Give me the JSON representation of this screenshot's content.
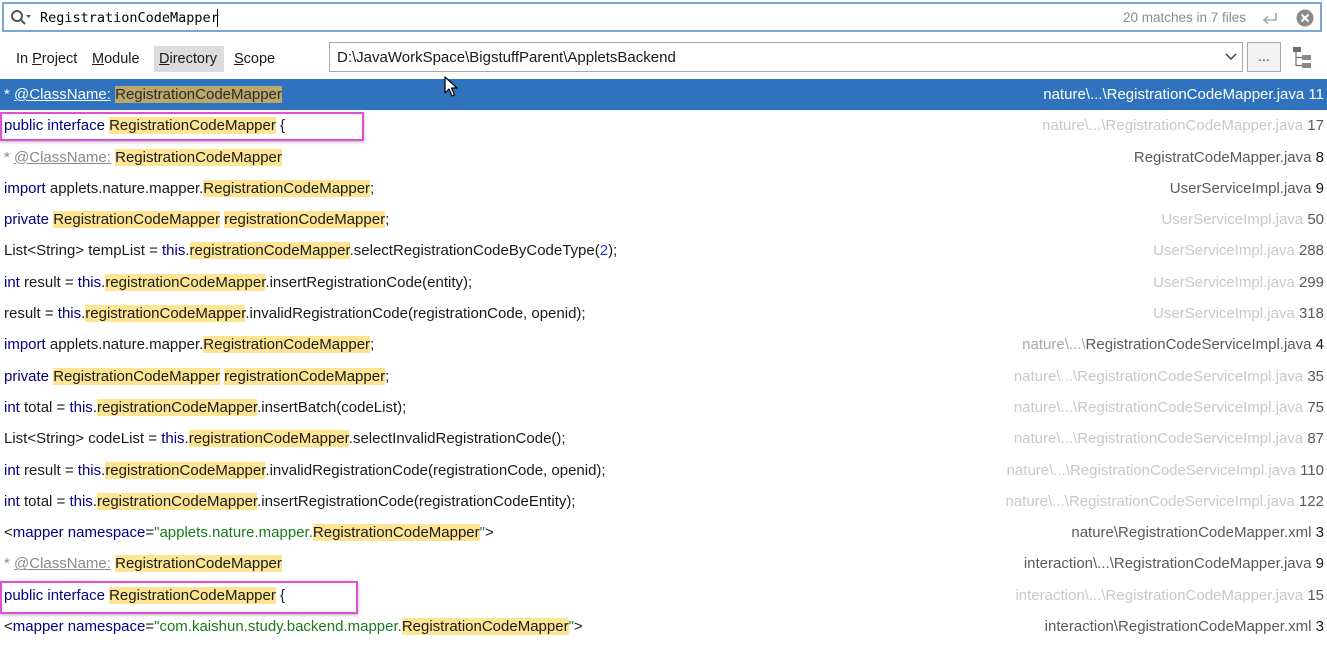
{
  "search": {
    "query": "RegistrationCodeMapper",
    "match_summary": "20 matches in 7 files"
  },
  "icons": {
    "search": "search-icon",
    "enter": "enter-icon",
    "clear": "clear-icon",
    "dropdown": "chevron-down-icon",
    "tree": "tree-view-icon",
    "cursor": "mouse-pointer-icon"
  },
  "scope_tabs": [
    {
      "pre": "In ",
      "mn": "P",
      "post": "roject",
      "selected": false
    },
    {
      "pre": "",
      "mn": "M",
      "post": "odule",
      "selected": false
    },
    {
      "pre": "",
      "mn": "D",
      "post": "irectory",
      "selected": true
    },
    {
      "pre": "",
      "mn": "S",
      "post": "cope",
      "selected": false
    }
  ],
  "directory": {
    "path": "D:\\JavaWorkSpace\\BigstuffParent\\AppletsBackend",
    "browse_label": "..."
  },
  "results": [
    {
      "parts": [
        [
          "doc",
          "* "
        ],
        [
          "doc-tag",
          "@ClassName:"
        ],
        [
          "t",
          " "
        ],
        [
          "hl",
          "RegistrationCodeMapper"
        ]
      ],
      "loc_path": "nature\\...\\",
      "loc_file": "RegistrationCodeMapper.java",
      "loc_line": "11",
      "selected": true,
      "gray": false
    },
    {
      "parts": [
        [
          "kw",
          "public"
        ],
        [
          "t",
          " "
        ],
        [
          "kw",
          "interface"
        ],
        [
          "t",
          " "
        ],
        [
          "hl",
          "RegistrationCodeMapper"
        ],
        [
          "t",
          " {"
        ]
      ],
      "loc_path": "nature\\...\\",
      "loc_file": "RegistrationCodeMapper.java",
      "loc_line": "17",
      "selected": false,
      "gray": true
    },
    {
      "parts": [
        [
          "doc",
          "* "
        ],
        [
          "doc-tag",
          "@ClassName:"
        ],
        [
          "t",
          " "
        ],
        [
          "hl",
          "RegistrationCodeMapper"
        ]
      ],
      "loc_path": "",
      "loc_file": "RegistratCodeMapper.java",
      "loc_line": "8",
      "selected": false,
      "gray": false
    },
    {
      "parts": [
        [
          "kw",
          "import"
        ],
        [
          "t",
          " applets.nature.mapper."
        ],
        [
          "hl",
          "RegistrationCodeMapper"
        ],
        [
          "t",
          ";"
        ]
      ],
      "loc_path": "",
      "loc_file": "UserServiceImpl.java",
      "loc_line": "9",
      "selected": false,
      "gray": false
    },
    {
      "parts": [
        [
          "kw",
          "private"
        ],
        [
          "t",
          " "
        ],
        [
          "hl",
          "RegistrationCodeMapper"
        ],
        [
          "t",
          " "
        ],
        [
          "hl",
          "registrationCodeMapper"
        ],
        [
          "t",
          ";"
        ]
      ],
      "loc_path": "",
      "loc_file": "UserServiceImpl.java",
      "loc_line": "50",
      "selected": false,
      "gray": true
    },
    {
      "parts": [
        [
          "t",
          "List<String> tempList = "
        ],
        [
          "kw",
          "this"
        ],
        [
          "t",
          "."
        ],
        [
          "hl",
          "registrationCodeMapper"
        ],
        [
          "t",
          ".selectRegistrationCodeByCodeType("
        ],
        [
          "num",
          "2"
        ],
        [
          "t",
          ");"
        ]
      ],
      "loc_path": "",
      "loc_file": "UserServiceImpl.java",
      "loc_line": "288",
      "selected": false,
      "gray": true
    },
    {
      "parts": [
        [
          "kw",
          "int"
        ],
        [
          "t",
          " result = "
        ],
        [
          "kw",
          "this"
        ],
        [
          "t",
          "."
        ],
        [
          "hl",
          "registrationCodeMapper"
        ],
        [
          "t",
          ".insertRegistrationCode(entity);"
        ]
      ],
      "loc_path": "",
      "loc_file": "UserServiceImpl.java",
      "loc_line": "299",
      "selected": false,
      "gray": true
    },
    {
      "parts": [
        [
          "t",
          "result = "
        ],
        [
          "kw",
          "this"
        ],
        [
          "t",
          "."
        ],
        [
          "hl",
          "registrationCodeMapper"
        ],
        [
          "t",
          ".invalidRegistrationCode(registrationCode, openid);"
        ]
      ],
      "loc_path": "",
      "loc_file": "UserServiceImpl.java",
      "loc_line": "318",
      "selected": false,
      "gray": true
    },
    {
      "parts": [
        [
          "kw",
          "import"
        ],
        [
          "t",
          " applets.nature.mapper."
        ],
        [
          "hl",
          "RegistrationCodeMapper"
        ],
        [
          "t",
          ";"
        ]
      ],
      "loc_path": "nature\\...\\",
      "loc_file": "RegistrationCodeServiceImpl.java",
      "loc_line": "4",
      "selected": false,
      "gray": false
    },
    {
      "parts": [
        [
          "kw",
          "private"
        ],
        [
          "t",
          " "
        ],
        [
          "hl",
          "RegistrationCodeMapper"
        ],
        [
          "t",
          " "
        ],
        [
          "hl",
          "registrationCodeMapper"
        ],
        [
          "t",
          ";"
        ]
      ],
      "loc_path": "nature\\...\\",
      "loc_file": "RegistrationCodeServiceImpl.java",
      "loc_line": "35",
      "selected": false,
      "gray": true
    },
    {
      "parts": [
        [
          "kw",
          "int"
        ],
        [
          "t",
          " total = "
        ],
        [
          "kw",
          "this"
        ],
        [
          "t",
          "."
        ],
        [
          "hl",
          "registrationCodeMapper"
        ],
        [
          "t",
          ".insertBatch(codeList);"
        ]
      ],
      "loc_path": "nature\\...\\",
      "loc_file": "RegistrationCodeServiceImpl.java",
      "loc_line": "75",
      "selected": false,
      "gray": true
    },
    {
      "parts": [
        [
          "t",
          "List<String> codeList = "
        ],
        [
          "kw",
          "this"
        ],
        [
          "t",
          "."
        ],
        [
          "hl",
          "registrationCodeMapper"
        ],
        [
          "t",
          ".selectInvalidRegistrationCode();"
        ]
      ],
      "loc_path": "nature\\...\\",
      "loc_file": "RegistrationCodeServiceImpl.java",
      "loc_line": "87",
      "selected": false,
      "gray": true
    },
    {
      "parts": [
        [
          "kw",
          "int"
        ],
        [
          "t",
          " result = "
        ],
        [
          "kw",
          "this"
        ],
        [
          "t",
          "."
        ],
        [
          "hl",
          "registrationCodeMapper"
        ],
        [
          "t",
          ".invalidRegistrationCode(registrationCode, openid);"
        ]
      ],
      "loc_path": "nature\\...\\",
      "loc_file": "RegistrationCodeServiceImpl.java",
      "loc_line": "110",
      "selected": false,
      "gray": true
    },
    {
      "parts": [
        [
          "kw",
          "int"
        ],
        [
          "t",
          " total = "
        ],
        [
          "kw",
          "this"
        ],
        [
          "t",
          "."
        ],
        [
          "hl",
          "registrationCodeMapper"
        ],
        [
          "t",
          ".insertRegistrationCode(registrationCodeEntity);"
        ]
      ],
      "loc_path": "nature\\...\\",
      "loc_file": "RegistrationCodeServiceImpl.java",
      "loc_line": "122",
      "selected": false,
      "gray": true
    },
    {
      "parts": [
        [
          "t",
          "<"
        ],
        [
          "kw",
          "mapper"
        ],
        [
          "t",
          " "
        ],
        [
          "kw",
          "namespace"
        ],
        [
          "t",
          "="
        ],
        [
          "str",
          "\"applets.nature.mapper."
        ],
        [
          "hl",
          "RegistrationCodeMapper"
        ],
        [
          "str",
          "\""
        ],
        [
          "t",
          ">"
        ]
      ],
      "loc_path": "",
      "loc_file": "nature\\RegistrationCodeMapper.xml",
      "loc_line": "3",
      "selected": false,
      "gray": false
    },
    {
      "parts": [
        [
          "doc",
          "* "
        ],
        [
          "doc-tag",
          "@ClassName:"
        ],
        [
          "t",
          " "
        ],
        [
          "hl",
          "RegistrationCodeMapper"
        ]
      ],
      "loc_path": "",
      "loc_file": "interaction\\...\\RegistrationCodeMapper.java",
      "loc_line": "9",
      "selected": false,
      "gray": false
    },
    {
      "parts": [
        [
          "kw",
          "public"
        ],
        [
          "t",
          " "
        ],
        [
          "kw",
          "interface"
        ],
        [
          "t",
          " "
        ],
        [
          "hl",
          "RegistrationCodeMapper"
        ],
        [
          "t",
          " {"
        ]
      ],
      "loc_path": "interaction\\...\\",
      "loc_file": "RegistrationCodeMapper.java",
      "loc_line": "15",
      "selected": false,
      "gray": true
    },
    {
      "parts": [
        [
          "t",
          "<"
        ],
        [
          "kw",
          "mapper"
        ],
        [
          "t",
          " "
        ],
        [
          "kw",
          "namespace"
        ],
        [
          "t",
          "="
        ],
        [
          "str",
          "\"com.kaishun.study.backend.mapper."
        ],
        [
          "hl",
          "RegistrationCodeMapper"
        ],
        [
          "str",
          "\""
        ],
        [
          "t",
          ">"
        ]
      ],
      "loc_path": "",
      "loc_file": "interaction\\RegistrationCodeMapper.xml",
      "loc_line": "3",
      "selected": false,
      "gray": false
    }
  ]
}
